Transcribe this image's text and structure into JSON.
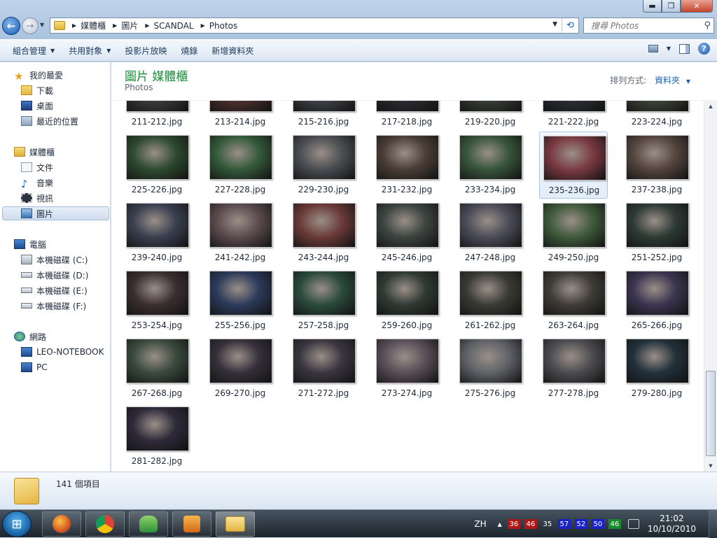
{
  "window": {
    "minimize_glyph": "▬",
    "maximize_glyph": "❐",
    "close_glyph": "✕"
  },
  "address": {
    "crumbs": [
      "媒體櫃",
      "圖片",
      "SCANDAL",
      "Photos"
    ]
  },
  "search": {
    "placeholder": "搜尋 Photos"
  },
  "toolbar": {
    "organize": "組合管理",
    "share": "共用對象",
    "slideshow": "投影片放映",
    "burn": "燒錄",
    "new_folder": "新增資料夾"
  },
  "nav": {
    "favorites": "我的最愛",
    "downloads": "下載",
    "desktop": "桌面",
    "recent": "最近的位置",
    "libraries": "媒體櫃",
    "documents": "文件",
    "music": "音樂",
    "videos": "視訊",
    "pictures": "圖片",
    "computer": "電腦",
    "drive_c": "本機磁碟 (C:)",
    "drive_d": "本機磁碟 (D:)",
    "drive_e": "本機磁碟 (E:)",
    "drive_f": "本機磁碟 (F:)",
    "network": "網路",
    "host_1": "LEO-NOTEBOOK",
    "host_2": "PC"
  },
  "header": {
    "title": "圖片 媒體櫃",
    "subtitle": "Photos",
    "arrange_label": "排列方式:",
    "arrange_value": "資料夾"
  },
  "files": [
    {
      "name": "211-212.jpg",
      "color": "#3a3a3a"
    },
    {
      "name": "213-214.jpg",
      "color": "#4a2f2f"
    },
    {
      "name": "215-216.jpg",
      "color": "#3d3f42"
    },
    {
      "name": "217-218.jpg",
      "color": "#2b2b2f"
    },
    {
      "name": "219-220.jpg",
      "color": "#363b34"
    },
    {
      "name": "221-222.jpg",
      "color": "#2a2c30"
    },
    {
      "name": "223-224.jpg",
      "color": "#3b4235"
    },
    {
      "name": "225-226.jpg",
      "color": "#2e4a30"
    },
    {
      "name": "227-228.jpg",
      "color": "#345a3a"
    },
    {
      "name": "229-230.jpg",
      "color": "#4a4d52"
    },
    {
      "name": "231-232.jpg",
      "color": "#4a3e36"
    },
    {
      "name": "233-234.jpg",
      "color": "#38553b"
    },
    {
      "name": "235-236.jpg",
      "color": "#7a3a42"
    },
    {
      "name": "237-238.jpg",
      "color": "#54453e"
    },
    {
      "name": "239-240.jpg",
      "color": "#3a4050"
    },
    {
      "name": "241-242.jpg",
      "color": "#5a4a4e"
    },
    {
      "name": "243-244.jpg",
      "color": "#6a3a38"
    },
    {
      "name": "245-246.jpg",
      "color": "#3c4440"
    },
    {
      "name": "247-248.jpg",
      "color": "#4a4c58"
    },
    {
      "name": "249-250.jpg",
      "color": "#3f5a3c"
    },
    {
      "name": "251-252.jpg",
      "color": "#2e3a34"
    },
    {
      "name": "253-254.jpg",
      "color": "#3a2e30"
    },
    {
      "name": "255-256.jpg",
      "color": "#2c3a5a"
    },
    {
      "name": "257-258.jpg",
      "color": "#2a4a3c"
    },
    {
      "name": "259-260.jpg",
      "color": "#2f3a33"
    },
    {
      "name": "261-262.jpg",
      "color": "#3a3a34"
    },
    {
      "name": "263-264.jpg",
      "color": "#3e3c36"
    },
    {
      "name": "265-266.jpg",
      "color": "#3b3550"
    },
    {
      "name": "267-268.jpg",
      "color": "#3a4a3c"
    },
    {
      "name": "269-270.jpg",
      "color": "#35303a"
    },
    {
      "name": "271-272.jpg",
      "color": "#3a3640"
    },
    {
      "name": "273-274.jpg",
      "color": "#5a4e58"
    },
    {
      "name": "275-276.jpg",
      "color": "#5f6268"
    },
    {
      "name": "277-278.jpg",
      "color": "#4c4c50"
    },
    {
      "name": "279-280.jpg",
      "color": "#22303a"
    },
    {
      "name": "281-282.jpg",
      "color": "#2e2a3a"
    }
  ],
  "selected_file": "235-236.jpg",
  "details": {
    "item_count": "141 個項目"
  },
  "taskbar": {
    "start_glyph": "⊞",
    "lang": "ZH",
    "tray_arrow": "▲",
    "temps": [
      {
        "value": "36",
        "color": "#b01818"
      },
      {
        "value": "46",
        "color": "#b01818"
      },
      {
        "value": "35",
        "color": "transparent"
      },
      {
        "value": "57",
        "color": "#1a22c8"
      },
      {
        "value": "52",
        "color": "#1a22c8"
      },
      {
        "value": "50",
        "color": "#1a22c8"
      },
      {
        "value": "46",
        "color": "#1a8a2a"
      }
    ],
    "time": "21:02",
    "date": "10/10/2010"
  }
}
